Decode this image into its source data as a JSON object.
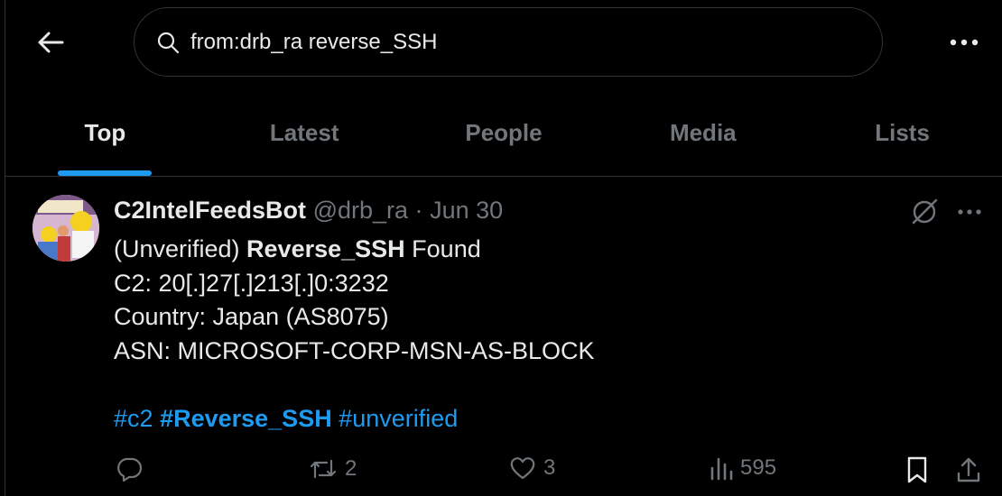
{
  "search": {
    "query": "from:drb_ra reverse_SSH"
  },
  "tabs": [
    {
      "label": "Top",
      "active": true
    },
    {
      "label": "Latest"
    },
    {
      "label": "People"
    },
    {
      "label": "Media"
    },
    {
      "label": "Lists"
    }
  ],
  "tweet": {
    "author_name": "C2IntelFeedsBot",
    "handle": "@drb_ra",
    "separator": "·",
    "date": "Jun 30",
    "line1_prefix": "(Unverified) ",
    "line1_bold": "Reverse_SSH",
    "line1_suffix": " Found",
    "line2": "C2: 20[.]27[.]213[.]0:3232",
    "line3": "Country: Japan (AS8075)",
    "line4": "ASN: MICROSOFT-CORP-MSN-AS-BLOCK",
    "hashtags": [
      "#c2",
      "#Reverse_SSH",
      "#unverified"
    ],
    "stats": {
      "replies": "",
      "reposts": "2",
      "likes": "3",
      "views": "595"
    }
  },
  "colors": {
    "accent": "#1d9bf0",
    "text": "#e7e9ea",
    "muted": "#71767b",
    "border": "#2f3336"
  }
}
